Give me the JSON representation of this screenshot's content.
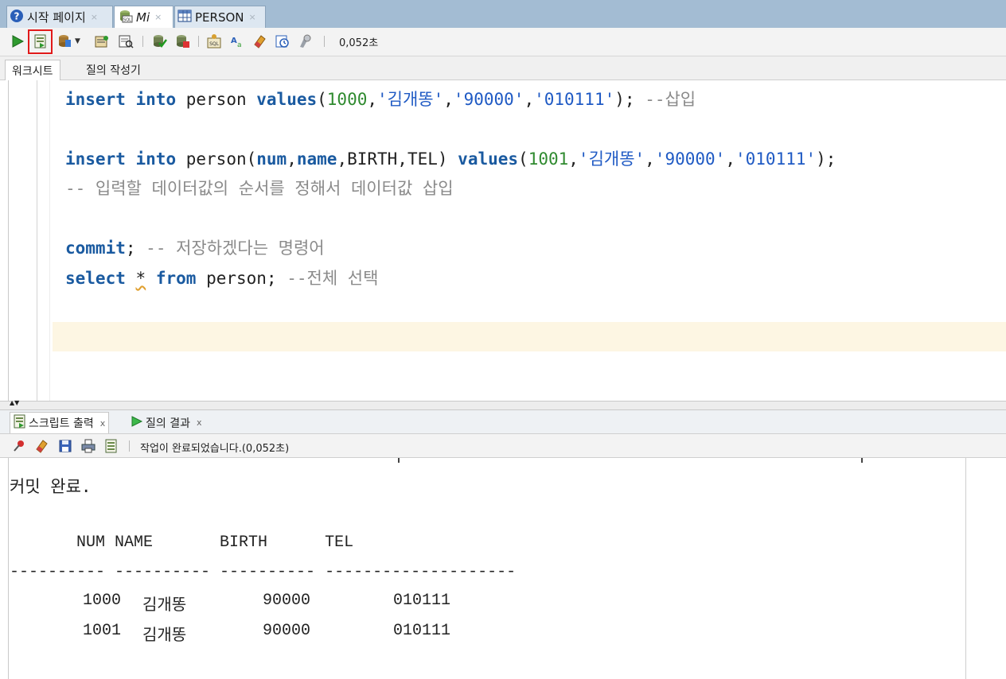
{
  "doc_tabs": [
    {
      "label": "시작 페이지",
      "icon": "help-icon",
      "close": "×"
    },
    {
      "label": "Mi",
      "icon": "sql-worksheet-icon",
      "close": "×"
    },
    {
      "label": "PERSON",
      "icon": "table-icon",
      "close": "×"
    }
  ],
  "toolbar": {
    "elapsed_time": "0,052초",
    "icons": [
      "run-statement-icon",
      "run-script-icon",
      "commit-icon",
      "dropdown-arrow-icon",
      "autotrace-icon",
      "explain-plan-icon",
      "commit-transaction-icon",
      "rollback-icon",
      "sql-tuning-icon",
      "text-case-icon",
      "eraser-icon",
      "history-icon",
      "format-icon"
    ]
  },
  "editor_tabs": {
    "worksheet": "워크시트",
    "query_builder": "질의 작성기"
  },
  "code": {
    "line1": {
      "kw1": "insert",
      "kw2": "into",
      "ident": "person",
      "kw3": "values",
      "open": "(",
      "n1": "1000",
      "c1": ",",
      "s1": "'김개똥'",
      "c2": ",",
      "s2": "'90000'",
      "c3": ",",
      "s3": "'010111'",
      "close": ");",
      "comment": "--삽입"
    },
    "line2": {
      "kw1": "insert",
      "kw2": "into",
      "ident": "person(",
      "col1": "num",
      "c1": ",",
      "col2": "name",
      "rest_cols": ",BIRTH,TEL)",
      "kw3": "values",
      "open": "(",
      "n1": "1001",
      "c2": ",",
      "s1": "'김개똥'",
      "c3": ",",
      "s2": "'90000'",
      "c4": ",",
      "s3": "'010111'",
      "close": ");"
    },
    "line3": "-- 입력할 데이터값의 순서를 정해서 데이터값 삽입",
    "line4": {
      "kw": "commit",
      "semi": ";",
      "comment": "-- 저장하겠다는 명령어"
    },
    "line5": {
      "kw1": "select",
      "star": "*",
      "kw2": "from",
      "ident": "person;",
      "comment": "--전체 선택"
    }
  },
  "output_tabs": [
    {
      "label": "스크립트 출력",
      "close": "x",
      "icon": "script-output-icon"
    },
    {
      "label": "질의 결과",
      "close": "x",
      "icon": "query-result-icon"
    }
  ],
  "output_toolbar": {
    "status": "작업이 완료되었습니다.(0,052초)",
    "icons": [
      "pin-icon",
      "eraser-icon",
      "save-icon",
      "print-icon",
      "script-icon"
    ]
  },
  "output": {
    "commit_msg": "커밋 완료.",
    "header": "       NUM NAME       BIRTH      TEL",
    "rule": "---------- ---------- ---------- --------------------",
    "rows": [
      {
        "num": "1000",
        "name": "김개똥",
        "birth": "90000",
        "tel": "010111"
      },
      {
        "num": "1001",
        "name": "김개똥",
        "birth": "90000",
        "tel": "010111"
      }
    ]
  }
}
